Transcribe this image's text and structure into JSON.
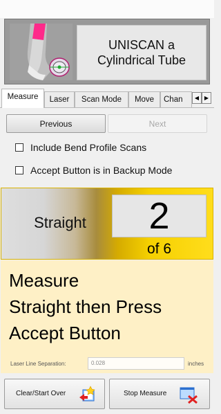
{
  "header": {
    "title": "UNISCAN a\nCylindrical Tube"
  },
  "tabs": [
    {
      "label": "Measure",
      "active": true
    },
    {
      "label": "Laser",
      "active": false
    },
    {
      "label": "Scan Mode",
      "active": false
    },
    {
      "label": "Move",
      "active": false
    },
    {
      "label": "Chan",
      "active": false
    }
  ],
  "tab_scroll": {
    "left_icon": "arrow-left-icon",
    "right_icon": "arrow-right-icon"
  },
  "nav": {
    "previous_label": "Previous",
    "next_label": "Next",
    "next_enabled": false
  },
  "options": [
    {
      "label": "Include Bend Profile Scans",
      "checked": false
    },
    {
      "label": "Accept Button is in Backup Mode",
      "checked": false
    }
  ],
  "status": {
    "segment_label": "Straight",
    "current": "2",
    "total_label": "of 6"
  },
  "instructions": {
    "line1": "Measure",
    "line2": "Straight then Press",
    "line3": "Accept Button"
  },
  "laser": {
    "label": "Laser Line Separation:",
    "value": "0.028",
    "units": "inches"
  },
  "actions": {
    "clear_label": "Clear/Start Over",
    "clear_icon": "clear-restart-icon",
    "stop_label": "Stop Measure",
    "stop_icon": "stop-measure-icon"
  },
  "colors": {
    "status_gradient_end": "#ffdd1c",
    "instructions_bg": "#fef0c6",
    "stop_x": "#e02020",
    "tube_pink": "#ff2a8a"
  }
}
